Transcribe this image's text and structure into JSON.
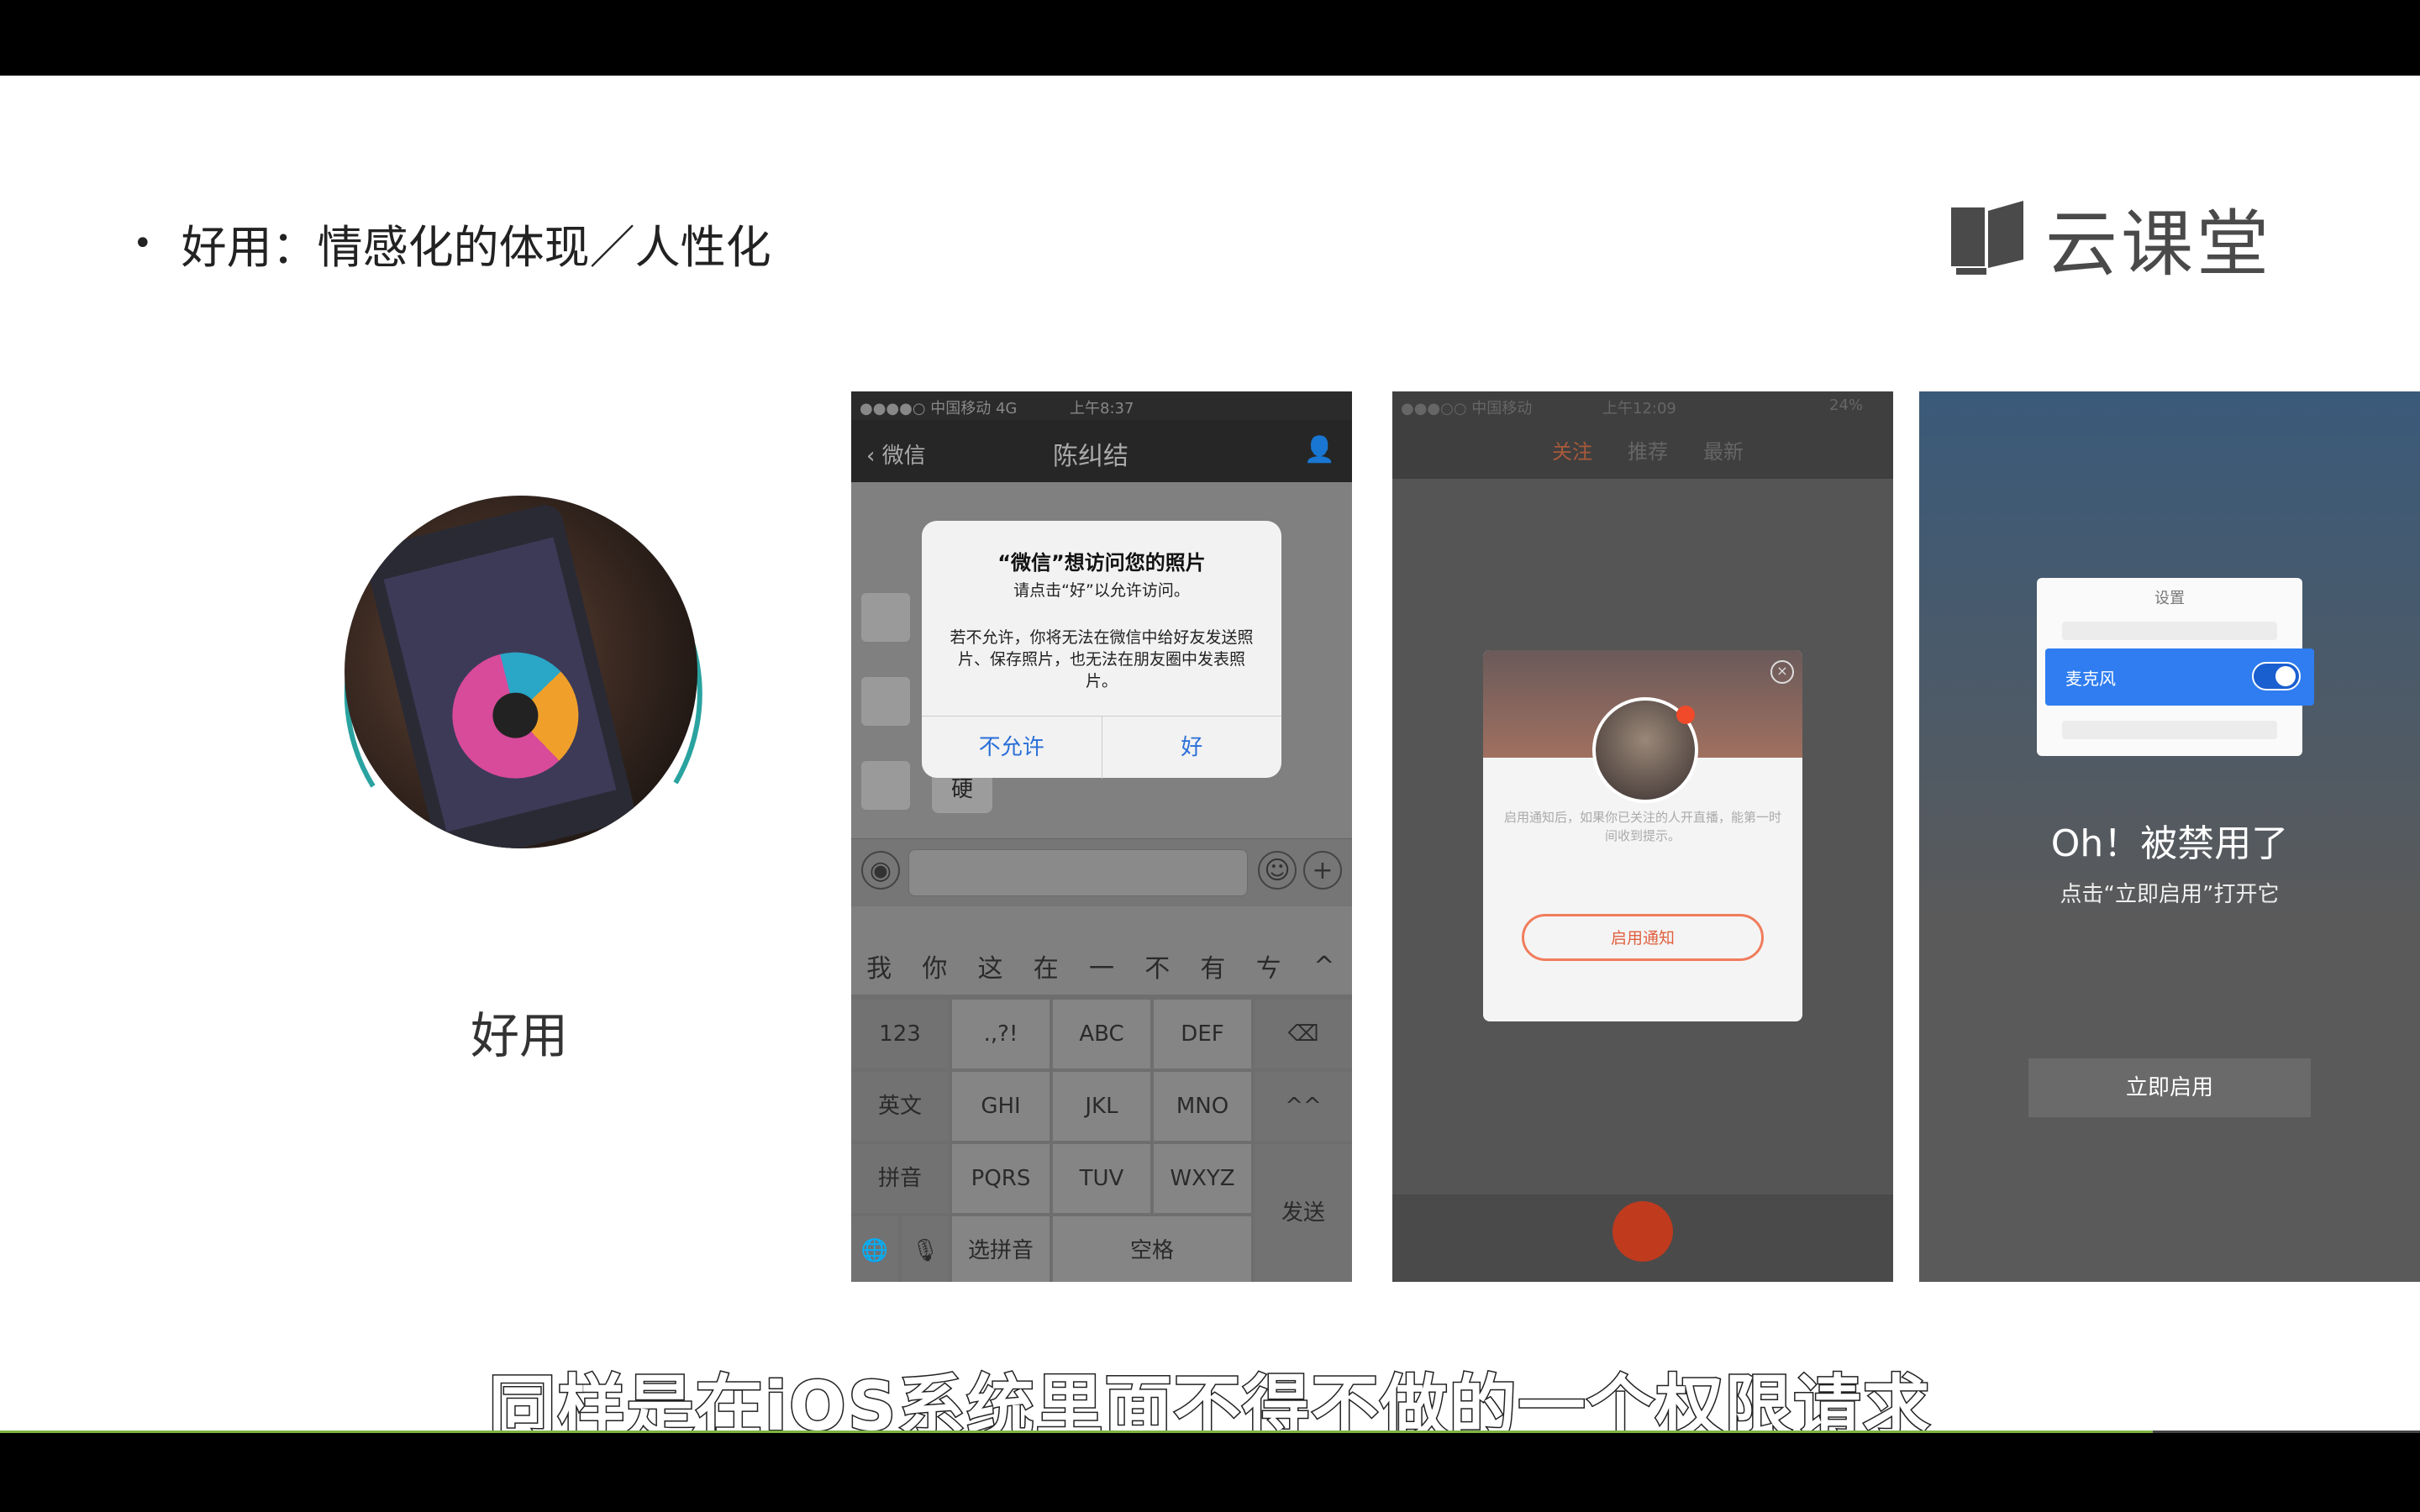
{
  "slide": {
    "bullet": "•",
    "heading": "好用：情感化的体现／人性化",
    "logo_text": "云课堂",
    "circle_label": "好用",
    "subtitle": "同样是在iOS系统里面不得不做的一个权限请求"
  },
  "shot1": {
    "status_carrier": "●●●●○ 中国移动  4G",
    "status_time": "上午8:37",
    "nav_back": "微信",
    "nav_title": "陈纠结",
    "dialog_title": "“微信”想访问您的照片",
    "dialog_sub": "请点击“好”以允许访问。",
    "dialog_body": "若不允许，你将无法在微信中给好友发送照片、保存照片，也无法在朋友圈中发表照片。",
    "btn_deny": "不允许",
    "btn_ok": "好",
    "bubble_text": "硬",
    "candidates": [
      "我",
      "你",
      "这",
      "在",
      "一",
      "不",
      "有",
      "ㄘ",
      "^"
    ],
    "keys": {
      "k123": "123",
      "punct": ".,?!",
      "abc": "ABC",
      "def": "DEF",
      "del": "⌫",
      "en": "英文",
      "ghi": "GHI",
      "jkl": "JKL",
      "mno": "MNO",
      "face": "^^",
      "pinyin": "拼音",
      "pqrs": "PQRS",
      "tuv": "TUV",
      "wxyz": "WXYZ",
      "send": "发送",
      "globe": "🌐",
      "mic": "🎙",
      "select": "选拼音",
      "space": "空格"
    }
  },
  "shot2": {
    "status_carrier": "●●●○○ 中国移动",
    "status_time": "上午12:09",
    "status_batt": "24%",
    "tab_follow": "关注",
    "tab_hot": "推荐",
    "tab_latest": "最新",
    "card_text": "启用通知后，如果你已关注的人开直播，能第一时间收到提示。",
    "card_btn": "启用通知"
  },
  "shot3": {
    "panel_title": "设置",
    "mic_label": "麦克风",
    "oh_title": "Oh！被禁用了",
    "oh_sub": "点击“立即启用”打开它",
    "enable_btn": "立即启用"
  },
  "colors": {
    "ring": "#2aa3a0",
    "progress": "#7cb342",
    "ios_blue": "#2a6fd8",
    "orange": "#f07c5c",
    "mic_blue": "#2f7df0"
  }
}
